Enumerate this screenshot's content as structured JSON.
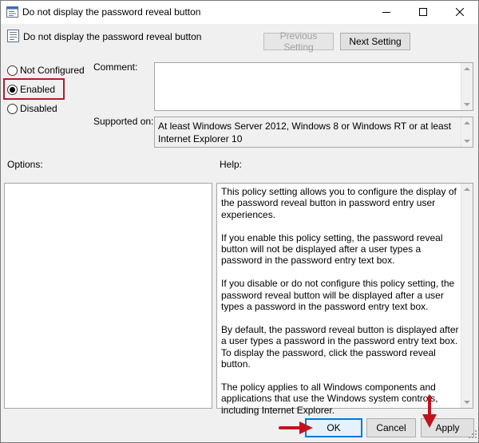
{
  "window": {
    "title": "Do not display the password reveal button"
  },
  "header": {
    "title": "Do not display the password reveal button",
    "previous_label": "Previous Setting",
    "next_label": "Next Setting"
  },
  "radio_options": [
    {
      "label": "Not Configured",
      "checked": false
    },
    {
      "label": "Enabled",
      "checked": true
    },
    {
      "label": "Disabled",
      "checked": false
    }
  ],
  "fields": {
    "comment_label": "Comment:",
    "comment_value": "",
    "supported_label": "Supported on:",
    "supported_value": "At least Windows Server 2012, Windows 8 or Windows RT or at least Internet Explorer 10"
  },
  "sections": {
    "options_label": "Options:",
    "help_label": "Help:"
  },
  "help_paragraphs": [
    "This policy setting allows you to configure the display of the password reveal button in password entry user experiences.",
    "If you enable this policy setting, the password reveal button will not be displayed after a user types a password in the password entry text box.",
    "If you disable or do not configure this policy setting, the password reveal button will be displayed after a user types a password in the password entry text box.",
    "By default, the password reveal button is displayed after a user types a password in the password entry text box. To display the password, click the password reveal button.",
    "The policy applies to all Windows components and applications that use the Windows system controls, including Internet Explorer."
  ],
  "footer": {
    "ok_label": "OK",
    "cancel_label": "Cancel",
    "apply_label": "Apply"
  },
  "colors": {
    "highlight_border": "#b21e2a",
    "annotation_arrow": "#c0141c",
    "default_button_border": "#0078d7"
  },
  "icons": {
    "app": "policy-settings-icon",
    "minimize": "minimize-icon",
    "maximize": "maximize-icon",
    "close": "close-icon"
  }
}
